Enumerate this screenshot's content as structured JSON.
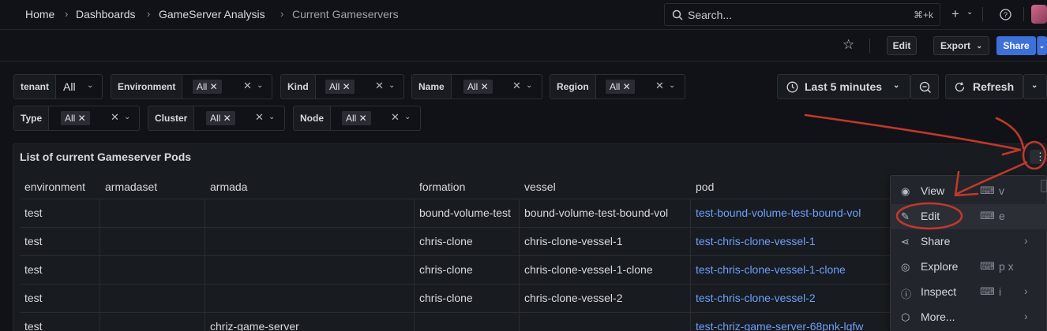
{
  "breadcrumb": {
    "home": "Home",
    "dashboards": "Dashboards",
    "folder": "GameServer Analysis",
    "current": "Current Gameservers"
  },
  "search": {
    "placeholder": "Search...",
    "shortcut": "⌘+k"
  },
  "toolbar": {
    "edit": "Edit",
    "export": "Export",
    "share": "Share"
  },
  "variables": [
    {
      "label": "tenant",
      "value": "All"
    },
    {
      "label": "Environment",
      "value": "All"
    },
    {
      "label": "Kind",
      "value": "All"
    },
    {
      "label": "Name",
      "value": "All"
    },
    {
      "label": "Region",
      "value": "All"
    },
    {
      "label": "Type",
      "value": "All"
    },
    {
      "label": "Cluster",
      "value": "All"
    },
    {
      "label": "Node",
      "value": "All"
    }
  ],
  "time_range": {
    "label": "Last 5 minutes"
  },
  "refresh": {
    "label": "Refresh"
  },
  "panel": {
    "title": "List of current Gameserver Pods",
    "columns": [
      "environment",
      "armadaset",
      "armada",
      "formation",
      "vessel",
      "pod"
    ],
    "rows": [
      [
        "test",
        "",
        "",
        "bound-volume-test",
        "bound-volume-test-bound-vol",
        "test-bound-volume-test-bound-vol"
      ],
      [
        "test",
        "",
        "",
        "chris-clone",
        "chris-clone-vessel-1",
        "test-chris-clone-vessel-1"
      ],
      [
        "test",
        "",
        "",
        "chris-clone",
        "chris-clone-vessel-1-clone",
        "test-chris-clone-vessel-1-clone"
      ],
      [
        "test",
        "",
        "",
        "chris-clone",
        "chris-clone-vessel-2",
        "test-chris-clone-vessel-2"
      ],
      [
        "test",
        "",
        "chriz-game-server",
        "",
        "",
        "test-chriz-game-server-68pnk-lqfw"
      ]
    ]
  },
  "menu": {
    "items": [
      {
        "label": "View",
        "shortcut": "v"
      },
      {
        "label": "Edit",
        "shortcut": "e"
      },
      {
        "label": "Share",
        "shortcut": ""
      },
      {
        "label": "Explore",
        "shortcut": "p x"
      },
      {
        "label": "Inspect",
        "shortcut": "i"
      },
      {
        "label": "More...",
        "shortcut": ""
      }
    ]
  },
  "colors": {
    "annotation": "#c0392b",
    "link": "#6e9fff",
    "primary": "#3d71d9"
  }
}
